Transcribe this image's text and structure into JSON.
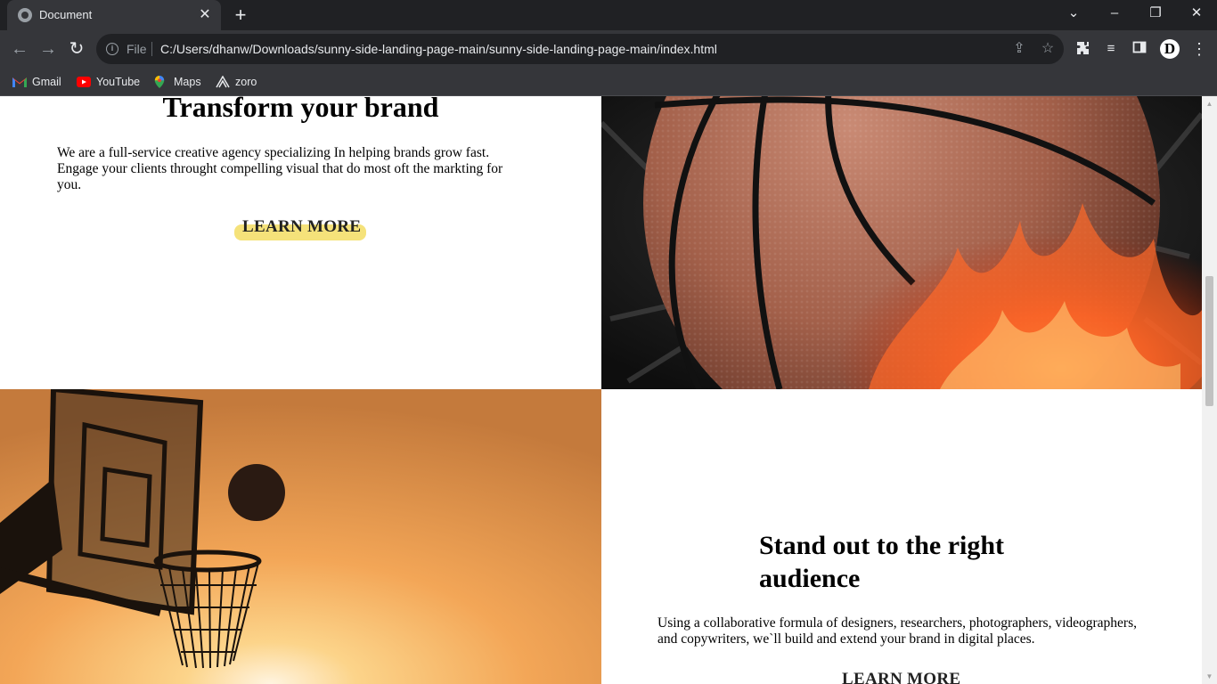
{
  "browser": {
    "tab_title": "Document",
    "new_tab_label": "+",
    "address": {
      "scheme_label": "File",
      "url": "C:/Users/dhanw/Downloads/sunny-side-landing-page-main/sunny-side-landing-page-main/index.html"
    },
    "profile_initial": "D",
    "bookmarks": [
      {
        "label": "Gmail",
        "icon": "gmail-icon"
      },
      {
        "label": "YouTube",
        "icon": "youtube-icon"
      },
      {
        "label": "Maps",
        "icon": "maps-icon"
      },
      {
        "label": "zoro",
        "icon": "zoro-icon"
      }
    ]
  },
  "page": {
    "transform": {
      "heading": "Transform your brand",
      "body": "We are a full-service creative agency specializing In helping brands grow fast. Engage your clients throught compelling visual that do most oft the markting for you.",
      "cta": "LEARN MORE"
    },
    "standout": {
      "heading": "Stand out to the right audience",
      "body": "Using a collaborative formula of designers, researchers, photographers, videographers, and copywriters, we`ll build and extend your brand in digital places.",
      "cta": "LEARN MORE"
    },
    "images": {
      "basketball_fire": "basketball-on-fire-photo",
      "hoop_sunset": "basketball-hoop-sunset-photo"
    }
  },
  "colors": {
    "chrome_dark": "#202124",
    "chrome_toolbar": "#35363a",
    "highlight_yellow": "#f5e27a",
    "sunset_orange": "#f0a450"
  }
}
